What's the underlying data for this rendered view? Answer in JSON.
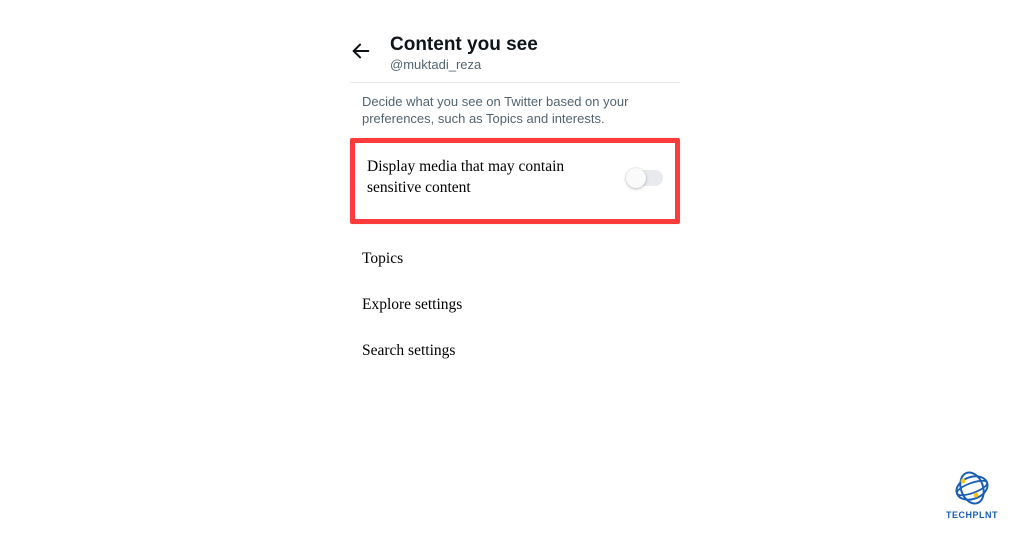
{
  "header": {
    "title": "Content you see",
    "username": "@muktadi_reza"
  },
  "description": "Decide what you see on Twitter based on your preferences, such as Topics and interests.",
  "sensitive_row": {
    "label": "Display media that may contain sensitive content",
    "toggle_state": "off"
  },
  "nav": {
    "items": [
      {
        "label": "Topics"
      },
      {
        "label": "Explore settings"
      },
      {
        "label": "Search settings"
      }
    ]
  },
  "branding": {
    "name": "TECHPLNT"
  }
}
